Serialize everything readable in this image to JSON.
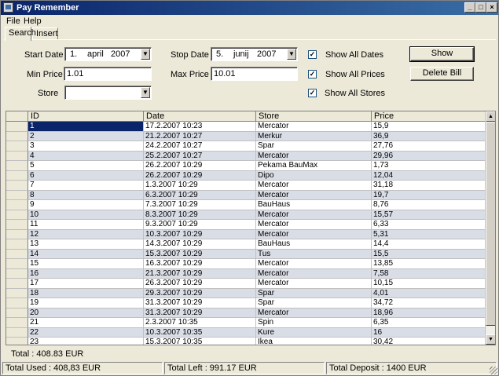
{
  "window": {
    "title": "Pay Remember"
  },
  "menu": [
    "File",
    "Help"
  ],
  "tabs": [
    "Search",
    "Insert"
  ],
  "filters": {
    "start_date_label": "Start Date",
    "start_date": {
      "day": "1.",
      "month": "april",
      "year": "2007"
    },
    "stop_date_label": "Stop Date",
    "stop_date": {
      "day": "5.",
      "month": "junij",
      "year": "2007"
    },
    "min_price_label": "Min Price",
    "min_price": "1.01",
    "max_price_label": "Max Price",
    "max_price": "10.01",
    "store_label": "Store",
    "store": "",
    "show_all_dates": {
      "label": "Show All Dates",
      "checked": "✓"
    },
    "show_all_prices": {
      "label": "Show All Prices",
      "checked": "✓"
    },
    "show_all_stores": {
      "label": "Show All Stores",
      "checked": "✓"
    }
  },
  "buttons": {
    "show": "Show",
    "delete_bill": "Delete Bill"
  },
  "table": {
    "columns": [
      "ID",
      "Date",
      "Store",
      "Price"
    ],
    "rows": [
      [
        "1",
        "17.2.2007 10:23",
        "Mercator",
        "15,9"
      ],
      [
        "2",
        "21.2.2007 10:27",
        "Merkur",
        "36,9"
      ],
      [
        "3",
        "24.2.2007 10:27",
        "Spar",
        "27,76"
      ],
      [
        "4",
        "25.2.2007 10:27",
        "Mercator",
        "29,96"
      ],
      [
        "5",
        "26.2.2007 10:29",
        "Pekama  BauMax",
        "1,73"
      ],
      [
        "6",
        "26.2.2007 10:29",
        "Dipo",
        "12,04"
      ],
      [
        "7",
        "1.3.2007 10:29",
        "Mercator",
        "31,18"
      ],
      [
        "8",
        "6.3.2007 10:29",
        "Mercator",
        "19,7"
      ],
      [
        "9",
        "7.3.2007 10:29",
        "BauHaus",
        "8,76"
      ],
      [
        "10",
        "8.3.2007 10:29",
        "Mercator",
        "15,57"
      ],
      [
        "11",
        "9.3.2007 10:29",
        "Mercator",
        "6,33"
      ],
      [
        "12",
        "10.3.2007 10:29",
        "Mercator",
        "5,31"
      ],
      [
        "13",
        "14.3.2007 10:29",
        "BauHaus",
        "14,4"
      ],
      [
        "14",
        "15.3.2007 10:29",
        "Tus",
        "15,5"
      ],
      [
        "15",
        "16.3.2007 10:29",
        "Mercator",
        "13,85"
      ],
      [
        "16",
        "21.3.2007 10:29",
        "Mercator",
        "7,58"
      ],
      [
        "17",
        "26.3.2007 10:29",
        "Mercator",
        "10,15"
      ],
      [
        "18",
        "29.3.2007 10:29",
        "Spar",
        "4,01"
      ],
      [
        "19",
        "31.3.2007 10:29",
        "Spar",
        "34,72"
      ],
      [
        "20",
        "31.3.2007 10:29",
        "Mercator",
        "18,96"
      ],
      [
        "21",
        "2.3.2007 10:35",
        "Spin",
        "6,35"
      ],
      [
        "22",
        "10.3.2007 10:35",
        "Kure",
        "16"
      ],
      [
        "23",
        "15.3.2007 10:35",
        "Ikea",
        "30,42"
      ]
    ]
  },
  "total": "Total : 408.83 EUR",
  "status": {
    "used": "Total Used : 408,83 EUR",
    "left": "Total Left : 991.17 EUR",
    "deposit": "Total Deposit : 1400 EUR"
  }
}
